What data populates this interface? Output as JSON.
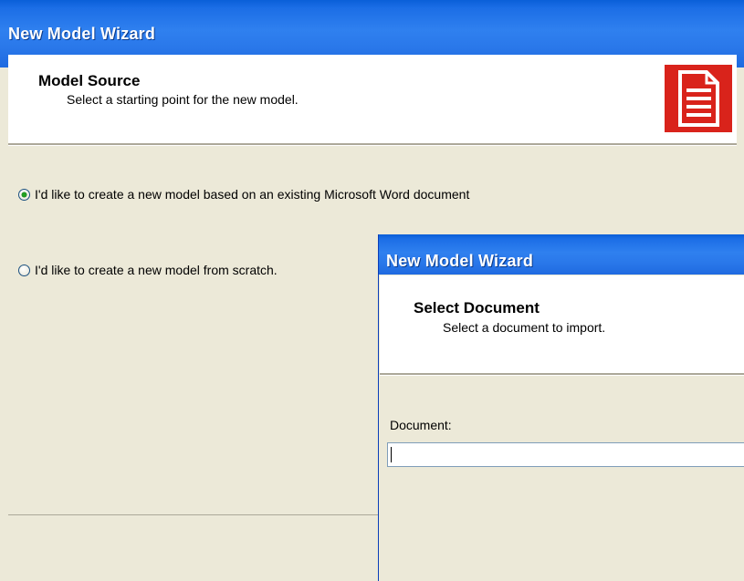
{
  "main_window": {
    "title": "New Model Wizard",
    "header": {
      "title": "Model Source",
      "subtitle": "Select a starting point for the new model.",
      "icon": "document-icon"
    },
    "options": [
      {
        "label": "I'd like to create a new model based on an existing Microsoft Word document",
        "selected": true
      },
      {
        "label": "I'd like to create a new model from scratch.",
        "selected": false
      }
    ]
  },
  "dialog": {
    "title": "New Model Wizard",
    "header": {
      "title": "Select Document",
      "subtitle": "Select a document to import."
    },
    "document_label": "Document:",
    "document_value": ""
  },
  "colors": {
    "titlebar": "#2f80ef",
    "icon_red": "#d9231b",
    "background": "#ece9d8"
  }
}
